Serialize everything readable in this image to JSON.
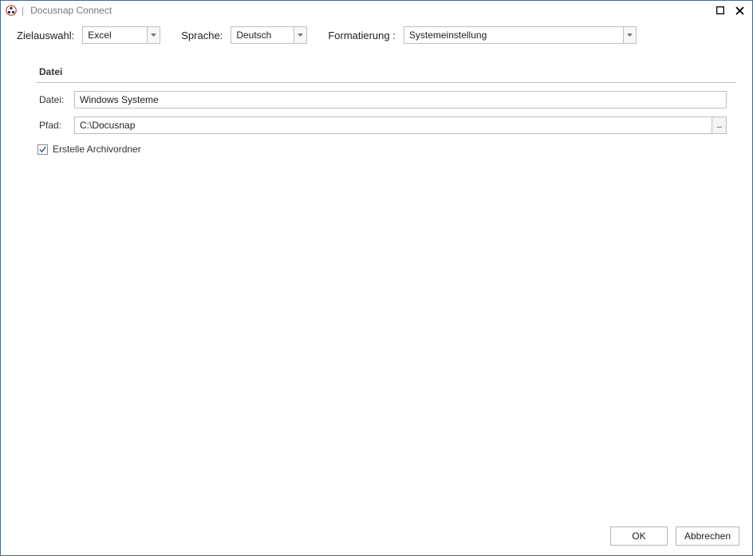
{
  "window": {
    "title": "Docusnap Connect"
  },
  "toolbar": {
    "target_label": "Zielauswahl:",
    "target_value": "Excel",
    "language_label": "Sprache:",
    "language_value": "Deutsch",
    "format_label": "Formatierung :",
    "format_value": "Systemeinstellung"
  },
  "section": {
    "header": "Datei",
    "file_label": "Datei:",
    "file_value": "Windows Systeme",
    "path_label": "Pfad:",
    "path_value": "C:\\Docusnap",
    "browse_button": "...",
    "archive_checkbox_label": "Erstelle Archivordner",
    "archive_checkbox_checked": true
  },
  "footer": {
    "ok_label": "OK",
    "cancel_label": "Abbrechen"
  }
}
